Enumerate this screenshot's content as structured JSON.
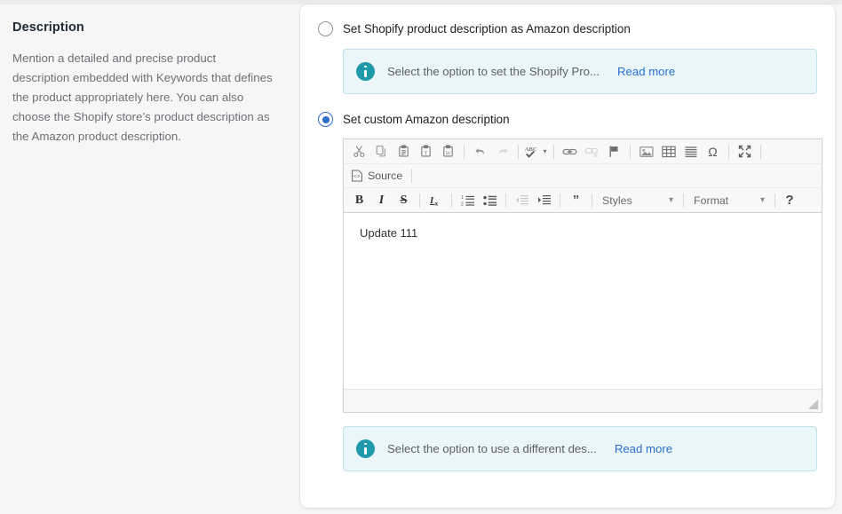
{
  "left": {
    "title": "Description",
    "body": "Mention a detailed and precise product description embedded with Keywords that defines the product appropriately here. You can also choose the Shopify store’s product description as the Amazon product description."
  },
  "options": [
    {
      "label": "Set Shopify product description as Amazon description",
      "selected": false,
      "banner": {
        "text": "Select the option to set the Shopify Pro...",
        "link": "Read more"
      }
    },
    {
      "label": "Set custom Amazon description",
      "selected": true,
      "banner": {
        "text": "Select the option to use a different des...",
        "link": "Read more"
      }
    }
  ],
  "editor": {
    "content": "Update 111",
    "toolbar": {
      "row1": [
        {
          "name": "cut-icon",
          "title": "Cut"
        },
        {
          "name": "copy-icon",
          "title": "Copy"
        },
        {
          "name": "paste-icon",
          "title": "Paste"
        },
        {
          "name": "paste-as-plain-text-icon",
          "title": "Paste as plain text"
        },
        {
          "name": "paste-from-word-icon",
          "title": "Paste from Word"
        },
        {
          "name": "undo-icon",
          "title": "Undo"
        },
        {
          "name": "redo-icon",
          "title": "Redo"
        },
        {
          "name": "spell-check-icon",
          "title": "Spell Check As You Type"
        },
        {
          "name": "link-icon",
          "title": "Link"
        },
        {
          "name": "unlink-icon",
          "title": "Unlink"
        },
        {
          "name": "anchor-flag-icon",
          "title": "Anchor"
        },
        {
          "name": "image-icon",
          "title": "Image"
        },
        {
          "name": "table-icon",
          "title": "Table"
        },
        {
          "name": "horizontal-rule-icon",
          "title": "Horizontal Line"
        },
        {
          "name": "special-character-icon",
          "title": "Insert Special Character"
        },
        {
          "name": "maximize-icon",
          "title": "Maximize"
        }
      ],
      "source_label": "Source",
      "row3": [
        {
          "name": "bold-icon",
          "title": "Bold",
          "glyph": "B"
        },
        {
          "name": "italic-icon",
          "title": "Italic",
          "glyph": "I"
        },
        {
          "name": "strikethrough-icon",
          "title": "Strikethrough",
          "glyph": "S"
        },
        {
          "name": "remove-format-icon",
          "title": "Remove Format"
        },
        {
          "name": "numbered-list-icon",
          "title": "Insert/Remove Numbered List"
        },
        {
          "name": "bulleted-list-icon",
          "title": "Insert/Remove Bulleted List"
        },
        {
          "name": "decrease-indent-icon",
          "title": "Decrease Indent"
        },
        {
          "name": "increase-indent-icon",
          "title": "Increase Indent"
        },
        {
          "name": "blockquote-icon",
          "title": "Block Quote",
          "glyph": "”"
        }
      ],
      "styles_label": "Styles",
      "format_label": "Format",
      "help_label": "?"
    }
  },
  "colors": {
    "page_background": "#f6f6f7",
    "card_background": "#ffffff",
    "banner_background": "#eaf6f9",
    "banner_border": "#bfe2ec",
    "info_icon": "#1f9aaa",
    "link": "#2a6fd4",
    "radio_selected": "#2c6ecb",
    "heading_text": "#212b36",
    "body_text": "#6d7175"
  }
}
